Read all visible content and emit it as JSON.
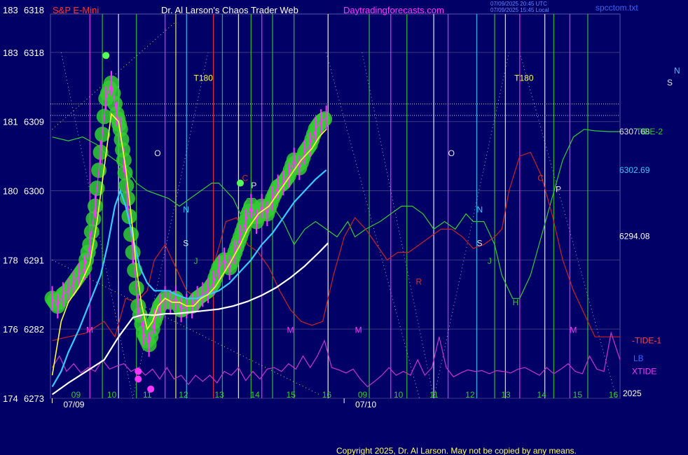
{
  "header": {
    "left_number": "183",
    "left_price": "6318",
    "symbol": "S&P E-Mini",
    "site_title": "Dr. Al Larson's Chaos Trader Web",
    "site_url": "Daytradingforecasts.com",
    "timestamp_utc": "07/09/2025 20:45 UTC",
    "timestamp_local": "07/09/2025 15:45 Local",
    "file_name": "spcctom.txt"
  },
  "colors": {
    "background": "#000066",
    "grid": "#3a3a80",
    "price_glow": "#33cc33",
    "price_bar": "#ff33ff",
    "ema_fast": "#ffff33",
    "ema_mid": "#33ccff",
    "ema_slow": "#ffffff",
    "tide_2": "#33cc33",
    "tide_1": "#cc2222",
    "xtide": "#cc33cc"
  },
  "chart_data": {
    "type": "line",
    "title": "S&P E-Mini",
    "ylim": [
      6273,
      6318
    ],
    "y_ticks": [
      {
        "index": "183",
        "price": "6318",
        "value": 6318
      },
      {
        "index": "181",
        "price": "6309",
        "value": 6309
      },
      {
        "index": "180",
        "price": "6300",
        "value": 6300
      },
      {
        "index": "178",
        "price": "6291",
        "value": 6291
      },
      {
        "index": "176",
        "price": "6282",
        "value": 6282
      },
      {
        "index": "174",
        "price": "6273",
        "value": 6273
      }
    ],
    "xlim": [
      8.5,
      24.4
    ],
    "x_tick_labels": [
      {
        "label": "09",
        "x": 9.2
      },
      {
        "label": "10",
        "x": 10.2
      },
      {
        "label": "11",
        "x": 11.2
      },
      {
        "label": "12",
        "x": 12.2
      },
      {
        "label": "13",
        "x": 13.2
      },
      {
        "label": "14",
        "x": 14.2
      },
      {
        "label": "15",
        "x": 15.2
      },
      {
        "label": "16",
        "x": 16.2
      },
      {
        "label": "09",
        "x": 17.2
      },
      {
        "label": "10",
        "x": 18.2
      },
      {
        "label": "11",
        "x": 19.2
      },
      {
        "label": "12",
        "x": 20.2
      },
      {
        "label": "13",
        "x": 21.2
      },
      {
        "label": "14",
        "x": 22.2
      },
      {
        "label": "15",
        "x": 23.2
      },
      {
        "label": "16",
        "x": 24.2
      }
    ],
    "date_labels": [
      {
        "label": "07/09",
        "x": 8.9
      },
      {
        "label": "07/10",
        "x": 17.05
      }
    ],
    "year_label": "2025",
    "right_labels": [
      {
        "label": "6307.68",
        "value": 6307.7,
        "color": "#e8e8e8"
      },
      {
        "label": "TIDE-2",
        "value": 6307.7,
        "color": "#33cc33"
      },
      {
        "label": "6302.69",
        "value": 6302.7,
        "color": "#33ccff"
      },
      {
        "label": "6294.08",
        "value": 6294.1,
        "color": "#ffffff"
      },
      {
        "label": "-TIDE-1",
        "value": 6280.5,
        "color": "#ff4444"
      },
      {
        "label": "LB",
        "value": 6278.2,
        "color": "#3366ff"
      },
      {
        "label": "XTIDE",
        "value": 6276.5,
        "color": "#ff33ff"
      },
      {
        "label": "N",
        "value": 6312,
        "color": "#33ccff"
      },
      {
        "label": "S",
        "value": 6310,
        "color": "#e8e8e8"
      }
    ],
    "hlines": [
      6311.3,
      6309.8
    ],
    "vlines": [
      {
        "x": 9.6,
        "color": "#ff33ff"
      },
      {
        "x": 9.95,
        "color": "#33cc33"
      },
      {
        "x": 10.4,
        "color": "#ffffff"
      },
      {
        "x": 10.9,
        "color": "#33cc33"
      },
      {
        "x": 11.7,
        "color": "#ff33ff"
      },
      {
        "x": 12.0,
        "color": "#ffff66"
      },
      {
        "x": 12.3,
        "color": "#33ccff"
      },
      {
        "x": 13.05,
        "color": "#ff3333"
      },
      {
        "x": 13.3,
        "color": "#33cc33"
      },
      {
        "x": 13.75,
        "color": "#ffffff"
      },
      {
        "x": 14.1,
        "color": "#33cc33"
      },
      {
        "x": 14.4,
        "color": "#ff33ff"
      },
      {
        "x": 14.7,
        "color": "#33cc33"
      },
      {
        "x": 15.3,
        "color": "#33cc33"
      },
      {
        "x": 16.25,
        "color": "#ffffff"
      },
      {
        "x": 17.4,
        "color": "#33cc33"
      },
      {
        "x": 18.0,
        "color": "#ff33ff"
      },
      {
        "x": 18.45,
        "color": "#33cc33"
      },
      {
        "x": 19.2,
        "color": "#ffffff"
      },
      {
        "x": 19.6,
        "color": "#ff33ff"
      },
      {
        "x": 20.4,
        "color": "#33ccff"
      },
      {
        "x": 20.9,
        "color": "#33cc33"
      },
      {
        "x": 21.2,
        "color": "#ffff66"
      },
      {
        "x": 21.6,
        "color": "#ff33ff"
      },
      {
        "x": 22.3,
        "color": "#ffffff"
      },
      {
        "x": 22.55,
        "color": "#33cc33"
      },
      {
        "x": 23.0,
        "color": "#ff33ff"
      },
      {
        "x": 23.5,
        "color": "#33cc33"
      }
    ],
    "markers": [
      {
        "text": "T180",
        "x": 12.5,
        "y": 6314.3,
        "color": "#ffff33"
      },
      {
        "text": "T180",
        "x": 21.45,
        "y": 6314.3,
        "color": "#ffff33"
      },
      {
        "text": "O",
        "x": 11.4,
        "y": 6304.5,
        "color": "#e8e8e8"
      },
      {
        "text": "O",
        "x": 19.6,
        "y": 6304.5,
        "color": "#e8e8e8"
      },
      {
        "text": "C",
        "x": 13.85,
        "y": 6301.3,
        "color": "#cc3333"
      },
      {
        "text": "C",
        "x": 22.1,
        "y": 6301.3,
        "color": "#cc3333"
      },
      {
        "text": "P",
        "x": 14.1,
        "y": 6300.3,
        "color": "#e8e8e8"
      },
      {
        "text": "P",
        "x": 22.6,
        "y": 6299.8,
        "color": "#e8e8e8"
      },
      {
        "text": "N",
        "x": 12.2,
        "y": 6297.2,
        "color": "#33ccff"
      },
      {
        "text": "N",
        "x": 20.4,
        "y": 6297.2,
        "color": "#33ccff"
      },
      {
        "text": "S",
        "x": 12.2,
        "y": 6292.8,
        "color": "#e8e8e8"
      },
      {
        "text": "S",
        "x": 20.4,
        "y": 6292.8,
        "color": "#e8e8e8"
      },
      {
        "text": "J",
        "x": 12.5,
        "y": 6290.5,
        "color": "#33cc33"
      },
      {
        "text": "J",
        "x": 20.7,
        "y": 6290.5,
        "color": "#33cc33"
      },
      {
        "text": "R",
        "x": 18.7,
        "y": 6287.8,
        "color": "#cc3333"
      },
      {
        "text": "M",
        "x": 9.5,
        "y": 6281.5,
        "color": "#ff33ff"
      },
      {
        "text": "M",
        "x": 15.1,
        "y": 6281.5,
        "color": "#ff33ff"
      },
      {
        "text": "M",
        "x": 17.0,
        "y": 6281.5,
        "color": "#ff33ff"
      },
      {
        "text": "M",
        "x": 23.0,
        "y": 6281.5,
        "color": "#ff33ff"
      },
      {
        "text": "H",
        "x": 21.4,
        "y": 6285.1,
        "color": "#33cc33"
      }
    ],
    "series": [
      {
        "name": "",
        "role": "price",
        "x": [
          8.55,
          8.7,
          8.85,
          9.0,
          9.15,
          9.3,
          9.45,
          9.6,
          9.75,
          9.9,
          10.05,
          10.2,
          10.35,
          10.45,
          10.55,
          10.65,
          10.8,
          10.95,
          11.1,
          11.25,
          11.4,
          11.55,
          11.7,
          11.85,
          12.0,
          12.15,
          12.3,
          12.45,
          12.6,
          12.75,
          12.9,
          13.05,
          13.2,
          13.35,
          13.5,
          13.65,
          13.8,
          13.95,
          14.1,
          14.25,
          14.4,
          14.55,
          14.7,
          14.85,
          15.0,
          15.15,
          15.3,
          15.45,
          15.6,
          15.75,
          15.9,
          16.05,
          16.2
        ],
        "values": [
          6286,
          6285,
          6286.5,
          6287,
          6288,
          6289,
          6290,
          6293,
          6298,
          6305,
          6312,
          6314,
          6310,
          6308,
          6304,
          6299,
          6292,
          6285,
          6281.5,
          6280,
          6283,
          6285,
          6286,
          6285.5,
          6286,
          6284.5,
          6285,
          6285,
          6286,
          6286.5,
          6287,
          6288,
          6290,
          6291,
          6290,
          6292,
          6294,
          6296,
          6298,
          6296,
          6298,
          6297,
          6299,
          6300.5,
          6301,
          6302,
          6304,
          6303,
          6305,
          6306,
          6308,
          6309,
          6309.5
        ]
      },
      {
        "name": "",
        "role": "ema_fast",
        "x": [
          8.55,
          8.8,
          9.0,
          9.3,
          9.6,
          9.8,
          10.0,
          10.2,
          10.4,
          10.6,
          10.75,
          10.9,
          11.05,
          11.2,
          11.35,
          11.5,
          11.7,
          11.9,
          12.1,
          12.3,
          12.5,
          12.7,
          12.9,
          13.1,
          13.3,
          13.5,
          13.8,
          14.0,
          14.3,
          14.6,
          14.9,
          15.2,
          15.5,
          15.8,
          16.0,
          16.2
        ],
        "values": [
          6276,
          6283,
          6285.5,
          6287.5,
          6290.5,
          6296,
          6303,
          6310,
          6309,
          6303,
          6297,
          6290,
          6285,
          6282,
          6283,
          6285,
          6286,
          6285.5,
          6285.5,
          6285,
          6285,
          6286,
          6286.5,
          6287.5,
          6289,
          6290.5,
          6293,
          6295,
          6297,
          6298,
          6300,
          6302,
          6304,
          6305.5,
          6307,
          6308
        ]
      },
      {
        "name": "",
        "role": "ema_mid",
        "x": [
          8.55,
          8.8,
          9.0,
          9.3,
          9.6,
          9.9,
          10.1,
          10.3,
          10.45,
          10.6,
          10.8,
          11.0,
          11.2,
          11.4,
          11.6,
          11.8,
          12.0,
          12.3,
          12.6,
          12.9,
          13.2,
          13.5,
          13.8,
          14.1,
          14.4,
          14.7,
          15.0,
          15.3,
          15.6,
          15.9,
          16.2
        ],
        "values": [
          6274.5,
          6276.5,
          6279,
          6282,
          6285.5,
          6289,
          6293,
          6298,
          6300,
          6298,
          6294,
          6290,
          6288,
          6287,
          6287,
          6287,
          6286.5,
          6286,
          6286,
          6286.5,
          6287,
          6288,
          6289.5,
          6291,
          6293,
          6294.5,
          6296.5,
          6298.5,
          6300,
          6301.5,
          6302.7
        ]
      },
      {
        "name": "",
        "role": "ema_slow",
        "x": [
          8.55,
          9.0,
          9.5,
          10.0,
          10.4,
          10.8,
          11.1,
          11.4,
          11.7,
          12.0,
          12.4,
          12.8,
          13.2,
          13.6,
          14.0,
          14.4,
          14.8,
          15.2,
          15.6,
          16.0,
          16.25
        ],
        "values": [
          6273.5,
          6275,
          6276.5,
          6278,
          6281,
          6283.5,
          6283.9,
          6283.8,
          6284,
          6284,
          6284.2,
          6284.4,
          6284.6,
          6285,
          6285.6,
          6286.4,
          6287.4,
          6288.7,
          6290.2,
          6292,
          6293.2
        ]
      },
      {
        "name": "",
        "role": "tide_2",
        "x": [
          8.55,
          9.0,
          9.4,
          9.8,
          10.0,
          10.3,
          10.6,
          10.9,
          11.2,
          11.5,
          11.8,
          12.1,
          12.4,
          12.7,
          13.0,
          13.2,
          13.4,
          13.6,
          13.8,
          14.0,
          14.2,
          14.4,
          14.7,
          15.0,
          15.3,
          15.6,
          15.9,
          16.2,
          16.5,
          16.8,
          17.0,
          17.3,
          17.7,
          18.0,
          18.3,
          18.6,
          18.9,
          19.2,
          19.5,
          19.8,
          20.1,
          20.3,
          20.6,
          20.9,
          21.1,
          21.4,
          21.6,
          21.9,
          22.2,
          22.5,
          22.8,
          23.1,
          23.4,
          23.7,
          24.1,
          24.4
        ],
        "values": [
          6307,
          6306.5,
          6307,
          6306,
          6305,
          6304,
          6303,
          6301,
          6300,
          6299.5,
          6299,
          6298,
          6299,
          6300,
          6301,
          6301,
          6300,
          6299,
          6297,
          6299,
          6299,
          6298,
          6298,
          6296,
          6293,
          6295,
          6296,
          6295,
          6294,
          6296,
          6294,
          6295,
          6296,
          6297,
          6298,
          6298,
          6297,
          6295,
          6296,
          6295,
          6297,
          6296,
          6296,
          6293,
          6289,
          6286,
          6286,
          6289,
          6294,
          6299,
          6304,
          6307,
          6308,
          6307.8,
          6307.7,
          6307.7
        ]
      },
      {
        "name": "",
        "role": "tide_1",
        "x": [
          8.55,
          9.0,
          9.5,
          10.0,
          10.3,
          10.6,
          10.9,
          11.2,
          11.4,
          11.7,
          12.0,
          12.3,
          12.6,
          12.9,
          13.1,
          13.4,
          13.7,
          14.0,
          14.3,
          14.6,
          14.9,
          15.2,
          15.5,
          15.8,
          16.1,
          16.4,
          16.7,
          17.0,
          17.3,
          17.6,
          17.9,
          18.2,
          18.5,
          18.8,
          19.1,
          19.4,
          19.7,
          20.0,
          20.3,
          20.6,
          20.9,
          21.1,
          21.3,
          21.6,
          21.9,
          22.2,
          22.5,
          22.8,
          23.1,
          23.4,
          23.7,
          24.0,
          24.4
        ],
        "values": [
          6280.5,
          6281,
          6281.5,
          6283,
          6281,
          6286,
          6285.5,
          6287,
          6291,
          6293,
          6290,
          6287,
          6286,
          6288,
          6291,
          6296,
          6296.5,
          6293,
          6292,
          6290,
          6287,
          6284.5,
          6283,
          6282.5,
          6283,
          6289,
          6294,
          6296.5,
          6295,
          6293,
          6291,
          6292,
          6292,
          6293,
          6294,
          6295,
          6295,
          6294,
          6292.5,
          6293,
          6294,
          6295,
          6300,
          6304.5,
          6305,
          6302,
          6297,
          6291,
          6287,
          6284,
          6281,
          6281,
          6281
        ]
      },
      {
        "name": "",
        "role": "xtide",
        "x": [
          8.55,
          8.75,
          8.95,
          9.15,
          9.35,
          9.55,
          9.75,
          9.95,
          10.15,
          10.35,
          10.55,
          10.75,
          10.95,
          11.15,
          11.35,
          11.55,
          11.75,
          11.95,
          12.15,
          12.35,
          12.55,
          12.75,
          12.95,
          13.15,
          13.35,
          13.55,
          13.75,
          13.95,
          14.15,
          14.35,
          14.55,
          14.75,
          14.95,
          15.15,
          15.35,
          15.55,
          15.75,
          15.95,
          16.15,
          16.35,
          16.55,
          16.75,
          16.95,
          17.15,
          17.35,
          17.55,
          17.75,
          17.95,
          18.15,
          18.35,
          18.55,
          18.75,
          18.95,
          19.15,
          19.35,
          19.55,
          19.75,
          19.95,
          20.15,
          20.35,
          20.55,
          20.75,
          20.95,
          21.15,
          21.35,
          21.55,
          21.75,
          21.95,
          22.15,
          22.35,
          22.55,
          22.75,
          22.95,
          23.15,
          23.35,
          23.55,
          23.75,
          23.95,
          24.15,
          24.4
        ],
        "values": [
          6277,
          6278.5,
          6276.5,
          6277.5,
          6276.3,
          6277,
          6276.5,
          6278,
          6276.8,
          6277.2,
          6277.5,
          6276.5,
          6277,
          6276,
          6276.8,
          6275.5,
          6277,
          6275.5,
          6276,
          6274.8,
          6276,
          6275.2,
          6276,
          6275,
          6276.5,
          6276,
          6277,
          6275.3,
          6276.5,
          6275.5,
          6276.8,
          6277,
          6276.5,
          6277.5,
          6276.8,
          6278.5,
          6277,
          6278.5,
          6280.5,
          6277,
          6276.7,
          6276.3,
          6276.8,
          6275.5,
          6274.5,
          6275.2,
          6276,
          6277,
          6276,
          6276.5,
          6276,
          6278,
          6276,
          6277,
          6281,
          6277,
          6275.8,
          6276.3,
          6276.7,
          6276.5,
          6276.6,
          6276.2,
          6276.6,
          6276.5,
          6276.3,
          6276.8,
          6277,
          6276.5,
          6276,
          6277,
          6276.2,
          6276.8,
          6277.5,
          6276.5,
          6276.2,
          6278.5,
          6276.8,
          6276.5,
          6281.5,
          6278
        ]
      }
    ],
    "grid": true
  },
  "footer": {
    "copyright": "Copyright 2025, Dr. Al Larson. May not be copied by any means."
  }
}
